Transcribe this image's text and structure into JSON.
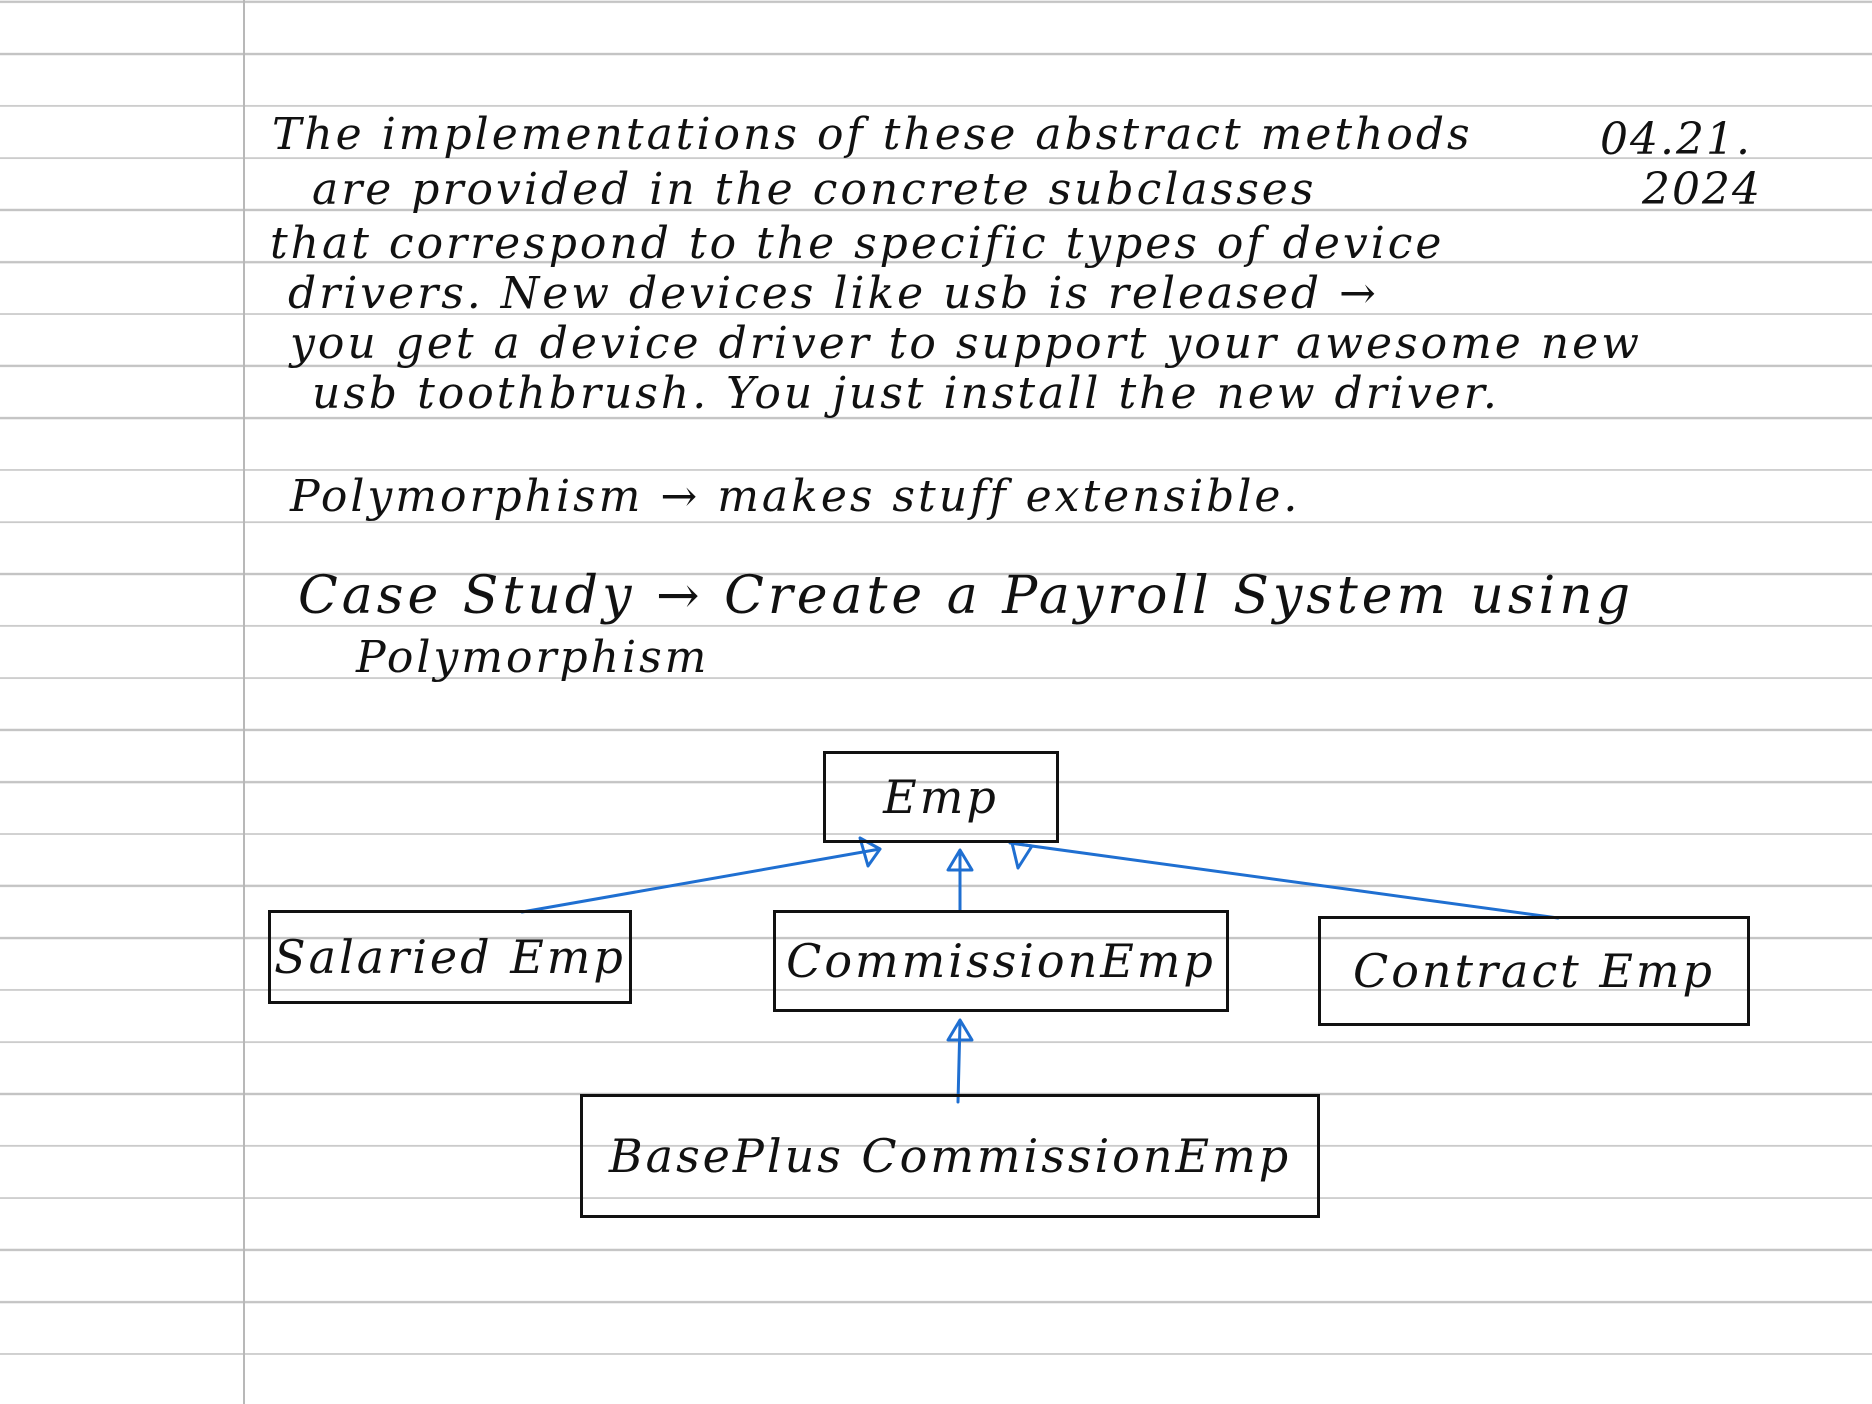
{
  "note": {
    "date_line_1": "04.21.",
    "date_line_2": "2024",
    "lines": [
      "The implementations of these abstract methods",
      "are provided in the concrete subclasses",
      "that correspond to the specific types of device",
      "drivers. New devices like usb is released →",
      "you get a device driver to support your awesome new",
      "usb toothbrush. You just install the new driver."
    ],
    "polymorphism_line": "Polymorphism → makes stuff extensible.",
    "case_study_line_1": "Case Study → Create a Payroll System using",
    "case_study_line_2": "Polymorphism"
  },
  "diagram": {
    "classes": [
      "Emp",
      "Salaried Emp",
      "CommissionEmp",
      "Contract Emp",
      "BasePlus CommissionEmp"
    ],
    "arrow_color": "#1f6fd1",
    "ink_color": "#111111"
  },
  "paper": {
    "rule_color": "#c4c4c4",
    "margin_color": "#b8b8b8"
  }
}
